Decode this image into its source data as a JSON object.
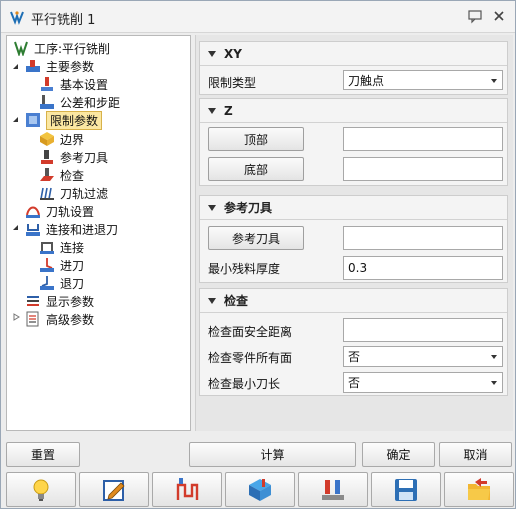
{
  "window": {
    "title": "平行铣削 1"
  },
  "tree": [
    {
      "label": "工序:平行铣削",
      "icon": "operation-icon"
    },
    {
      "label": "主要参数",
      "icon": "main-params-icon"
    },
    {
      "label": "基本设置",
      "icon": "basic-settings-icon"
    },
    {
      "label": "公差和步距",
      "icon": "tolerance-icon"
    },
    {
      "label": "限制参数",
      "icon": "limit-params-icon"
    },
    {
      "label": "边界",
      "icon": "boundary-icon"
    },
    {
      "label": "参考刀具",
      "icon": "reference-tool-icon"
    },
    {
      "label": "检查",
      "icon": "check-icon"
    },
    {
      "label": "刀轨过滤",
      "icon": "toolpath-filter-icon"
    },
    {
      "label": "刀轨设置",
      "icon": "toolpath-settings-icon"
    },
    {
      "label": "连接和进退刀",
      "icon": "link-icon"
    },
    {
      "label": "连接",
      "icon": "connect-icon"
    },
    {
      "label": "进刀",
      "icon": "lead-in-icon"
    },
    {
      "label": "退刀",
      "icon": "lead-out-icon"
    },
    {
      "label": "显示参数",
      "icon": "display-params-icon"
    },
    {
      "label": "高级参数",
      "icon": "advanced-params-icon"
    }
  ],
  "sections": {
    "xy": {
      "title": "XY",
      "limit_type_label": "限制类型",
      "limit_type_value": "刀触点"
    },
    "z": {
      "title": "Z",
      "top_button": "顶部",
      "top_value": "",
      "bottom_button": "底部",
      "bottom_value": ""
    },
    "ref_tool": {
      "title": "参考刀具",
      "ref_tool_button": "参考刀具",
      "ref_tool_value": "",
      "min_stock_label": "最小残料厚度",
      "min_stock_value": "0.3"
    },
    "check": {
      "title": "检查",
      "safe_dist_label": "检查面安全距离",
      "safe_dist_value": "",
      "all_faces_label": "检查零件所有面",
      "all_faces_value": "否",
      "min_length_label": "检查最小刀长",
      "min_length_value": "否"
    }
  },
  "buttons": {
    "reset": "重置",
    "calculate": "计算",
    "ok": "确定",
    "cancel": "取消"
  },
  "icon_buttons": [
    "lightbulb-icon",
    "edit-icon",
    "toolpath-icon",
    "simulation-icon",
    "compare-icon",
    "save-icon",
    "open-folder-icon"
  ]
}
